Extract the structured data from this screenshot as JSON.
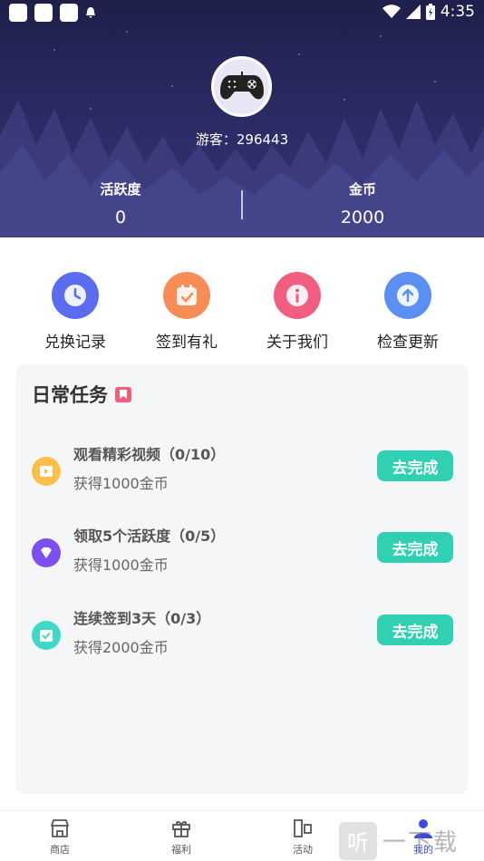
{
  "status_bar": {
    "time": "4:35"
  },
  "profile": {
    "username": "游客：296443"
  },
  "stats": [
    {
      "label": "活跃度",
      "value": "0"
    },
    {
      "label": "金币",
      "value": "2000"
    }
  ],
  "quick_actions": [
    {
      "label": "兑换记录",
      "color": "#5b6cf0",
      "icon": "clock-icon"
    },
    {
      "label": "签到有礼",
      "color": "#f78c57",
      "icon": "calendar-check-icon"
    },
    {
      "label": "关于我们",
      "color": "#f25d82",
      "icon": "info-icon"
    },
    {
      "label": "检查更新",
      "color": "#5b8ff2",
      "icon": "upload-arrow-icon"
    }
  ],
  "daily_tasks": {
    "title": "日常任务",
    "items": [
      {
        "name": "观看精彩视频（0/10）",
        "reward": "获得1000金币",
        "button": "去完成",
        "icon_color": "#f9c14a",
        "icon": "video-play-icon"
      },
      {
        "name": "领取5个活跃度（0/5）",
        "reward": "获得1000金币",
        "button": "去完成",
        "icon_color": "#7b4ff0",
        "icon": "diamond-icon"
      },
      {
        "name": "连续签到3天（0/3）",
        "reward": "获得2000金币",
        "button": "去完成",
        "icon_color": "#3fd9c8",
        "icon": "calendar-check-icon"
      }
    ]
  },
  "bottom_nav": [
    {
      "label": "商店",
      "icon": "store-icon"
    },
    {
      "label": "福利",
      "icon": "gift-icon"
    },
    {
      "label": "活动",
      "icon": "activity-icon"
    },
    {
      "label": "我的",
      "icon": "user-icon",
      "active": true
    }
  ],
  "watermark": {
    "badge": "听",
    "text": "一下载"
  },
  "colors": {
    "accent_button": "#2fd1b2",
    "nav_active": "#3b49df"
  }
}
